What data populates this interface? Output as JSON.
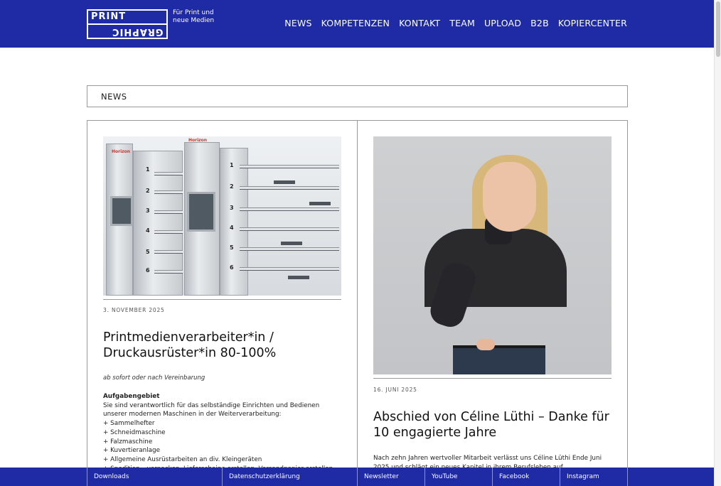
{
  "brand": {
    "logo_top": "PRINT",
    "logo_bottom": "GRAPHIC",
    "tagline": "Für Print und neue Medien",
    "header_color": "#1f2aa5"
  },
  "nav": {
    "items": [
      "NEWS",
      "KOMPETENZEN",
      "KONTAKT",
      "TEAM",
      "UPLOAD",
      "B2B",
      "KOPIERCENTER"
    ]
  },
  "section": {
    "title": "NEWS"
  },
  "posts": [
    {
      "date": "3. NOVEMBER 2025",
      "title": "Printmedienverarbeiter*in / Druckausrüster*in 80-100%",
      "meta": "ab sofort oder nach Vereinbarung",
      "body_heading": "Aufgabengebiet",
      "body_lines": [
        "Sie sind verantwortlich für das selbständige Einrichten und Bedienen unserer modernen Maschinen in der Weiterverarbeitung:",
        "+ Sammelhefter",
        "+ Schneidmaschine",
        "+ Falzmaschine",
        "+ Kuvertieranlage",
        "+ Allgemeine Ausrüstarbeiten an div. Kleingeräten",
        "+ Spedition – verpacken, Lieferscheine erstellen, Versandpapier erstellen"
      ],
      "image_brand": "Horizon",
      "image_icon": "collator-machine-photo"
    },
    {
      "date": "16. JUNI 2025",
      "title": "Abschied von Céline Lüthi – Danke für 10 engagierte Jahre",
      "body_lines": [
        "Nach zehn Jahren wertvoller Mitarbeit verlässt uns Céline Lüthi Ende Juni 2025 und schlägt ein neues Kapitel in ihrem Berufsleben auf."
      ],
      "image_icon": "portrait-photo"
    }
  ],
  "footer": {
    "links": [
      "Downloads",
      "Datenschutzerklärung",
      "Newsletter",
      "YouTube",
      "Facebook",
      "Instagram"
    ]
  }
}
